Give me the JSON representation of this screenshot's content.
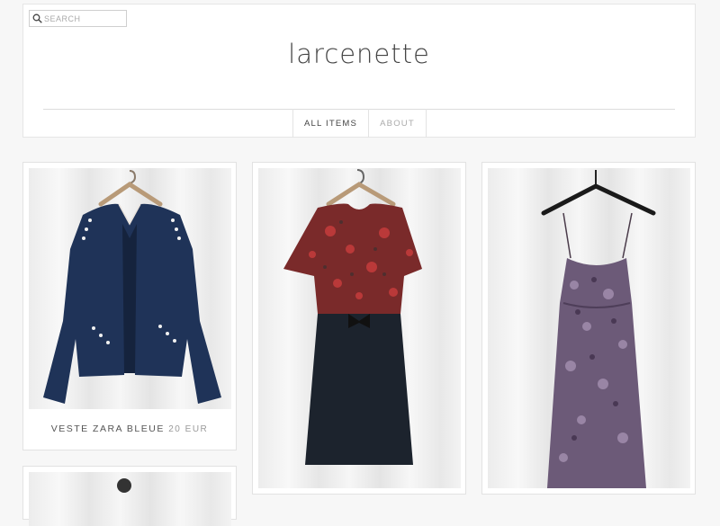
{
  "site": {
    "logo": "larcenette"
  },
  "search": {
    "placeholder": "SEARCH",
    "icon": "search-icon"
  },
  "nav": {
    "items": [
      {
        "label": "ALL ITEMS"
      },
      {
        "label": "ABOUT"
      }
    ]
  },
  "products": [
    {
      "name": "VESTE ZARA BLEUE",
      "price": "20",
      "currency": "EUR"
    }
  ]
}
